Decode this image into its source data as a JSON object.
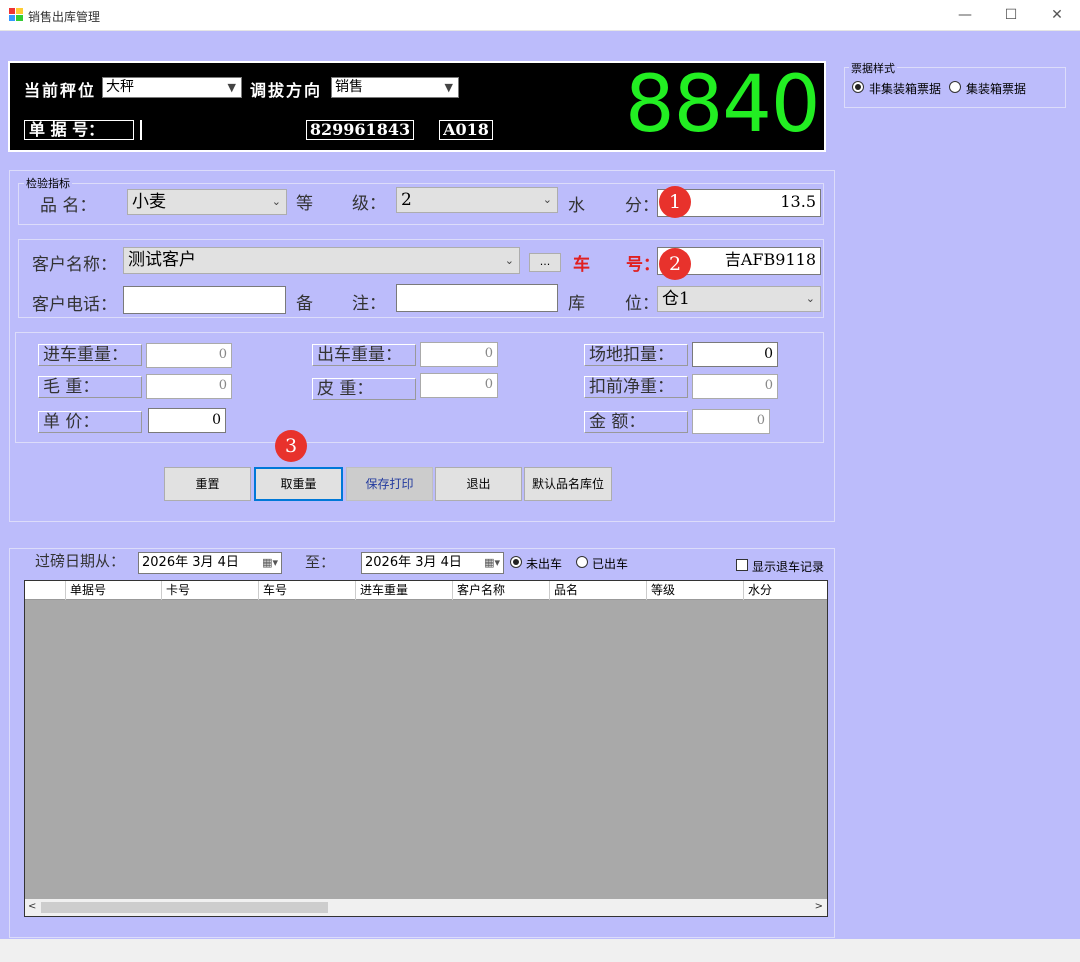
{
  "window": {
    "title": "销售出库管理",
    "minimize": "—",
    "maximize": "☐",
    "close": "✕"
  },
  "display": {
    "scale_label": "当前秤位",
    "scale_value": "大秤",
    "direction_label": "调拔方向",
    "direction_value": "销售",
    "doc_label": "单 据 号：",
    "doc_number": "829961843",
    "code": "A018",
    "weight": "8840"
  },
  "ticket_style": {
    "title": "票据样式",
    "option1": "非集装箱票据",
    "option2": "集装箱票据",
    "selected": "option1"
  },
  "inspection": {
    "group_label": "检验指标",
    "product_label": "品      名：",
    "product_value": "小麦",
    "grade_label": "等",
    "grade_label2": "级：",
    "grade_value": "2",
    "moisture_label": "水",
    "moisture_label2": "分：",
    "moisture_value": "13.5"
  },
  "customer": {
    "name_label": "客户名称：",
    "name_value": "测试客户",
    "ellipsis": "...",
    "plate_label": "车",
    "plate_label2": "号：",
    "plate_value": "吉AFB9118",
    "phone_label": "客户电话：",
    "phone_value": "",
    "remark_label": "备",
    "remark_label2": "注：",
    "remark_value": "",
    "warehouse_label": "库",
    "warehouse_label2": "位：",
    "warehouse_value": "仓1"
  },
  "weights": {
    "in_weight_label": "进车重量：",
    "in_weight": "0",
    "out_weight_label": "出车重量：",
    "out_weight": "0",
    "site_deduct_label": "场地扣量：",
    "site_deduct": "0",
    "gross_label": "毛      重：",
    "gross": "0",
    "tare_label": "皮      重：",
    "tare": "0",
    "pre_net_label": "扣前净重：",
    "pre_net": "0",
    "price_label": "单      价：",
    "price": "0",
    "amount_label": "金      额：",
    "amount": "0"
  },
  "buttons": {
    "reset": "重置",
    "get_weight": "取重量",
    "save_print": "保存打印",
    "exit": "退出",
    "default_loc": "默认品名库位"
  },
  "badges": {
    "b1": "1",
    "b2": "2",
    "b3": "3"
  },
  "filter": {
    "from_label": "过磅日期从：",
    "from_date": "2026年  3月  4日",
    "to_label": "至：",
    "to_date": "2026年  3月  4日",
    "not_out": "未出车",
    "out": "已出车",
    "show_return": "显示退车记录"
  },
  "table": {
    "columns": [
      "单据号",
      "卡号",
      "车号",
      "进车重量",
      "客户名称",
      "品名",
      "等级",
      "水分"
    ]
  }
}
